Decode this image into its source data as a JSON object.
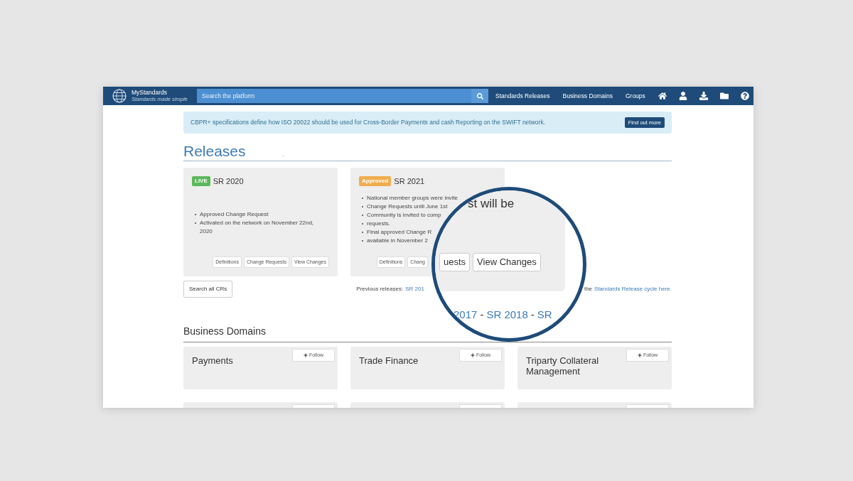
{
  "navbar": {
    "logo_title": "MyStandards",
    "logo_subtitle": "Standards made simple",
    "search": {
      "placeholder": "Search the platform"
    },
    "links": [
      "Standards Releases",
      "Business Domains",
      "Groups"
    ]
  },
  "banner": {
    "text": "CBPR+ specifications define how ISO 20022 should be used for Cross-Border Payments and cash Reporting on the SWIFT network.",
    "button": "Find out more"
  },
  "releases": {
    "title": "Releases",
    "dot": ".",
    "cards": [
      {
        "badge": "LIVE",
        "kind": "live",
        "title": "SR 2020",
        "bullets": [
          "Approved Change Request",
          "Activated on the network on November 22nd, 2020"
        ],
        "buttons": [
          "Definitions",
          "Change Requests",
          "View Changes"
        ]
      },
      {
        "badge": "Approved",
        "kind": "approved",
        "title": "SR 2021",
        "bullets": [
          "National member groups were invite",
          "Change Requests until June 1st",
          "Community is invited to comp",
          "requests.",
          "Final approved Change R",
          "available in November 2"
        ],
        "buttons": [
          "Definitions",
          "Chang"
        ]
      }
    ],
    "search_button": "Search all CRs",
    "previous_label": "Previous releases:",
    "previous_link": "SR 201",
    "cycle_prefix": "the",
    "cycle_link": "Standards Release cycle here."
  },
  "magnifier": {
    "heading_fragment": "st will be",
    "buttons": [
      "uests",
      "View Changes"
    ],
    "release_line": [
      {
        "kind": "link",
        "text": "2017"
      },
      {
        "kind": "sep",
        "text": "-"
      },
      {
        "kind": "link",
        "text": "SR 2018"
      },
      {
        "kind": "sep",
        "text": "-"
      },
      {
        "kind": "link",
        "text": "SR"
      }
    ]
  },
  "business_domains": {
    "title": "Business Domains",
    "cards": [
      {
        "name": "Payments",
        "follow": "Follow"
      },
      {
        "name": "Trade Finance",
        "follow": "Follow"
      },
      {
        "name": "Triparty Collateral Management",
        "follow": "Follow"
      }
    ]
  }
}
